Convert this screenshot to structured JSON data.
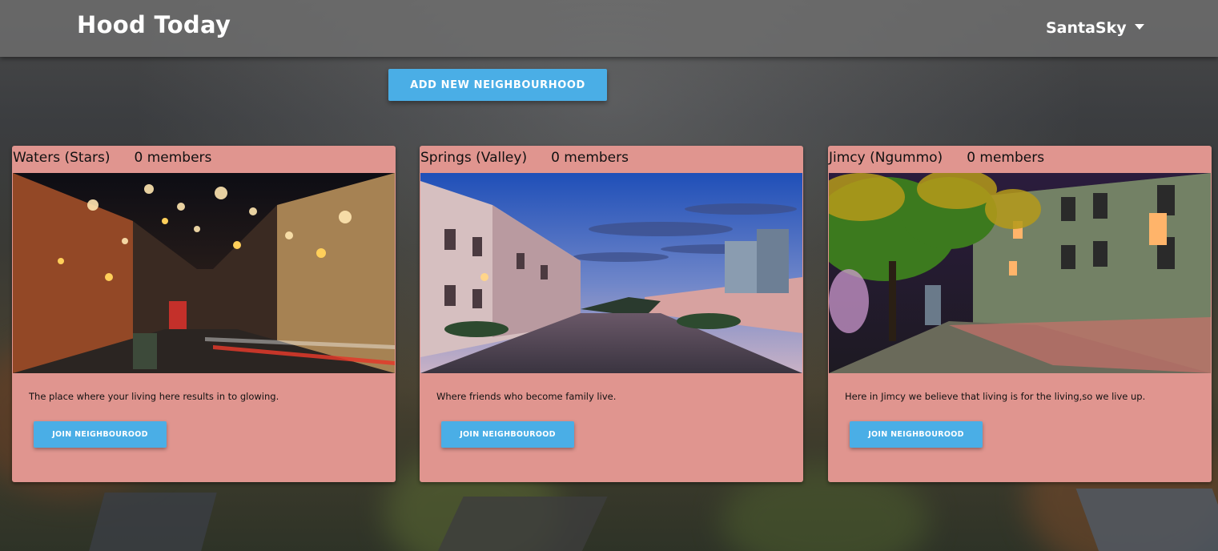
{
  "navbar": {
    "brand": "Hood Today",
    "user_name": "SantaSky"
  },
  "actions": {
    "add_label": "ADD NEW NEIGHBOURHOOD"
  },
  "neighbourhoods": [
    {
      "name": "Waters (Stars)",
      "members": "0 members",
      "description": "The place where your living here results in to glowing.",
      "join_label": "JOIN NEIGHBOUROOD"
    },
    {
      "name": "Springs (Valley)",
      "members": "0 members",
      "description": "Where friends who become family live.",
      "join_label": "JOIN NEIGHBOUROOD"
    },
    {
      "name": "Jimcy (Ngummo)",
      "members": "0 members",
      "description": "Here in Jimcy we believe that living is for the living,so we live up.",
      "join_label": "JOIN NEIGHBOUROOD"
    }
  ],
  "colors": {
    "accent": "#4aaee6",
    "card_bg": "#e0958f",
    "navbar_bg": "#6e6e6e"
  }
}
